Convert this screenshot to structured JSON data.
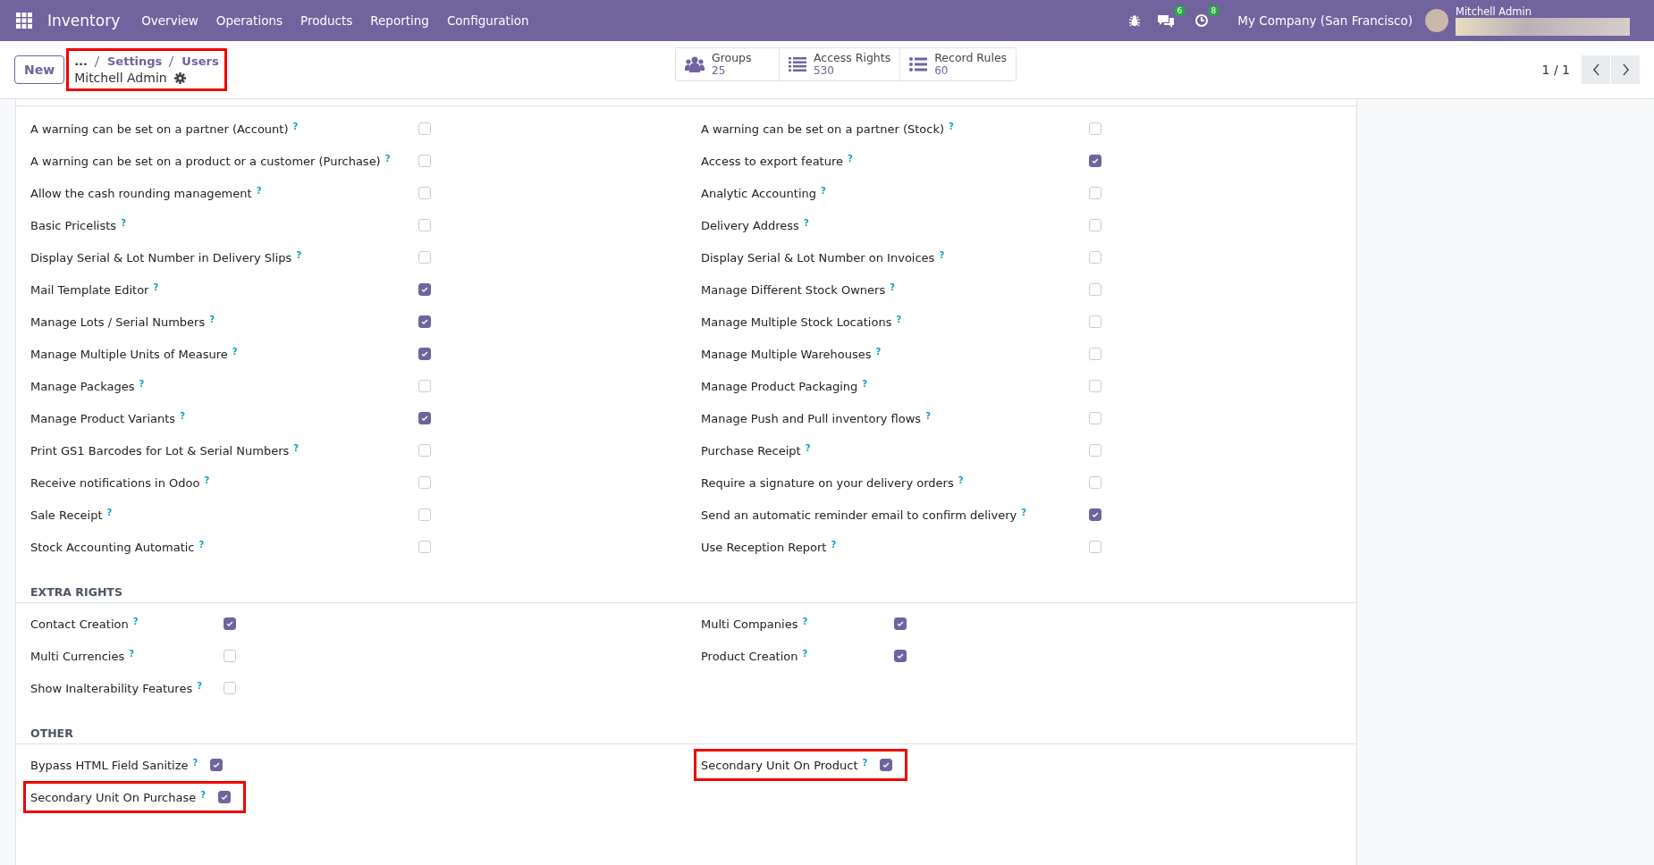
{
  "navbar": {
    "app_name": "Inventory",
    "menu": [
      "Overview",
      "Operations",
      "Products",
      "Reporting",
      "Configuration"
    ],
    "messages_count": "6",
    "activities_count": "8",
    "company": "My Company (San Francisco)",
    "user_name": "Mitchell Admin"
  },
  "control_panel": {
    "new_button": "New",
    "breadcrumb": {
      "ellipsis": "...",
      "items": [
        "Settings",
        "Users"
      ],
      "highlighted": true
    },
    "record_title": "Mitchell Admin",
    "smart_buttons": [
      {
        "kind": "groups",
        "label": "Groups",
        "value": "25"
      },
      {
        "kind": "list",
        "label": "Access Rights",
        "value": "530"
      },
      {
        "kind": "rules",
        "label": "Record Rules",
        "value": "60"
      }
    ],
    "pager": "1 / 1"
  },
  "sections": [
    {
      "columns": [
        [
          {
            "label": "A warning can be set on a partner (Account)",
            "help": "?",
            "checked": false,
            "highlighted": false
          },
          {
            "label": "A warning can be set on a product or a customer (Purchase)",
            "help": "?",
            "checked": false,
            "highlighted": false
          },
          {
            "label": "Allow the cash rounding management",
            "help": "?",
            "checked": false,
            "highlighted": false
          },
          {
            "label": "Basic Pricelists",
            "help": "?",
            "checked": false,
            "highlighted": false
          },
          {
            "label": "Display Serial & Lot Number in Delivery Slips",
            "help": "?",
            "checked": false,
            "highlighted": false
          },
          {
            "label": "Mail Template Editor",
            "help": "?",
            "checked": true,
            "highlighted": false
          },
          {
            "label": "Manage Lots / Serial Numbers",
            "help": "?",
            "checked": true,
            "highlighted": false
          },
          {
            "label": "Manage Multiple Units of Measure",
            "help": "?",
            "checked": true,
            "highlighted": false
          },
          {
            "label": "Manage Packages",
            "help": "?",
            "checked": false,
            "highlighted": false
          },
          {
            "label": "Manage Product Variants",
            "help": "?",
            "checked": true,
            "highlighted": false
          },
          {
            "label": "Print GS1 Barcodes for Lot & Serial Numbers",
            "help": "?",
            "checked": false,
            "highlighted": false
          },
          {
            "label": "Receive notifications in Odoo",
            "help": "?",
            "checked": false,
            "highlighted": false
          },
          {
            "label": "Sale Receipt",
            "help": "?",
            "checked": false,
            "highlighted": false
          },
          {
            "label": "Stock Accounting Automatic",
            "help": "?",
            "checked": false,
            "highlighted": false
          }
        ],
        [
          {
            "label": "A warning can be set on a partner (Stock)",
            "help": "?",
            "checked": false,
            "highlighted": false
          },
          {
            "label": "Access to export feature",
            "help": "?",
            "checked": true,
            "highlighted": false
          },
          {
            "label": "Analytic Accounting",
            "help": "?",
            "checked": false,
            "highlighted": false
          },
          {
            "label": "Delivery Address",
            "help": "?",
            "checked": false,
            "highlighted": false
          },
          {
            "label": "Display Serial & Lot Number on Invoices",
            "help": "?",
            "checked": false,
            "highlighted": false
          },
          {
            "label": "Manage Different Stock Owners",
            "help": "?",
            "checked": false,
            "highlighted": false
          },
          {
            "label": "Manage Multiple Stock Locations",
            "help": "?",
            "checked": false,
            "highlighted": false
          },
          {
            "label": "Manage Multiple Warehouses",
            "help": "?",
            "checked": false,
            "highlighted": false
          },
          {
            "label": "Manage Product Packaging",
            "help": "?",
            "checked": false,
            "highlighted": false
          },
          {
            "label": "Manage Push and Pull inventory flows",
            "help": "?",
            "checked": false,
            "highlighted": false
          },
          {
            "label": "Purchase Receipt",
            "help": "?",
            "checked": false,
            "highlighted": false
          },
          {
            "label": "Require a signature on your delivery orders",
            "help": "?",
            "checked": false,
            "highlighted": false
          },
          {
            "label": "Send an automatic reminder email to confirm delivery",
            "help": "?",
            "checked": true,
            "highlighted": false
          },
          {
            "label": "Use Reception Report",
            "help": "?",
            "checked": false,
            "highlighted": false
          }
        ]
      ]
    },
    {
      "title": "EXTRA RIGHTS",
      "columns": [
        [
          {
            "label": "Contact Creation",
            "help": "?",
            "checked": true,
            "highlighted": false
          },
          {
            "label": "Multi Currencies",
            "help": "?",
            "checked": false,
            "highlighted": false
          },
          {
            "label": "Show Inalterability Features",
            "help": "?",
            "checked": false,
            "highlighted": false
          }
        ],
        [
          {
            "label": "Multi Companies",
            "help": "?",
            "checked": true,
            "highlighted": false
          },
          {
            "label": "Product Creation",
            "help": "?",
            "checked": true,
            "highlighted": false
          }
        ]
      ]
    },
    {
      "title": "OTHER",
      "columns": [
        [
          {
            "label": "Bypass HTML Field Sanitize",
            "help": "?",
            "checked": true,
            "highlighted": false
          },
          {
            "label": "Secondary Unit On Purchase",
            "help": "?",
            "checked": true,
            "highlighted": true
          }
        ],
        [
          {
            "label": "Secondary Unit On Product",
            "help": "?",
            "checked": true,
            "highlighted": true
          }
        ]
      ]
    }
  ]
}
